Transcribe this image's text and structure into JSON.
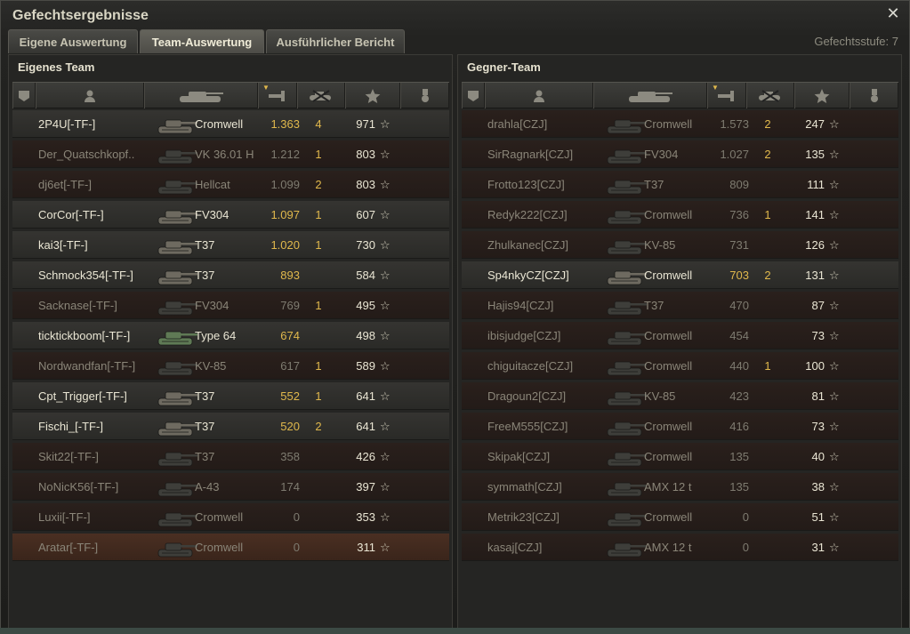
{
  "window": {
    "title": "Gefechtsergebnisse",
    "close_glyph": "✕"
  },
  "tabs": [
    {
      "label": "Eigene Auswertung",
      "active": false
    },
    {
      "label": "Team-Auswertung",
      "active": true
    },
    {
      "label": "Ausführlicher Bericht",
      "active": false
    }
  ],
  "battle_tier": "Gefechtsstufe: 7",
  "columns": [
    "squad-icon",
    "player-icon",
    "tank-icon",
    "damage-icon",
    "kills-icon",
    "xp-star-icon",
    "medal-icon"
  ],
  "own_team": {
    "title": "Eigenes Team",
    "rows": [
      {
        "name": "2P4U[-TF-]",
        "tank": "Cromwell",
        "damage": "1.363",
        "kills": "4",
        "xp": "971",
        "state": "alive",
        "tank_color": "#6e6a60"
      },
      {
        "name": "Der_Quatschkopf..",
        "tank": "VK 36.01 H",
        "damage": "1.212",
        "kills": "1",
        "xp": "803",
        "state": "dead",
        "tank_color": "#3e3e3a"
      },
      {
        "name": "dj6et[-TF-]",
        "tank": "Hellcat",
        "damage": "1.099",
        "kills": "2",
        "xp": "803",
        "state": "dead",
        "tank_color": "#3e3e3a"
      },
      {
        "name": "CorCor[-TF-]",
        "tank": "FV304",
        "damage": "1.097",
        "kills": "1",
        "xp": "607",
        "state": "alive",
        "tank_color": "#6e6a60"
      },
      {
        "name": "kai3[-TF-]",
        "tank": "T37",
        "damage": "1.020",
        "kills": "1",
        "xp": "730",
        "state": "alive",
        "tank_color": "#6e6a60"
      },
      {
        "name": "Schmock354[-TF-]",
        "tank": "T37",
        "damage": "893",
        "kills": "",
        "xp": "584",
        "state": "alive",
        "tank_color": "#6e6a60"
      },
      {
        "name": "Sacknase[-TF-]",
        "tank": "FV304",
        "damage": "769",
        "kills": "1",
        "xp": "495",
        "state": "dead",
        "tank_color": "#3e3e3a"
      },
      {
        "name": "ticktickboom[-TF-]",
        "tank": "Type 64",
        "damage": "674",
        "kills": "",
        "xp": "498",
        "state": "alive",
        "tank_color": "#5f7a55"
      },
      {
        "name": "Nordwandfan[-TF-]",
        "tank": "KV-85",
        "damage": "617",
        "kills": "1",
        "xp": "589",
        "state": "dead",
        "tank_color": "#3e3e3a"
      },
      {
        "name": "Cpt_Trigger[-TF-]",
        "tank": "T37",
        "damage": "552",
        "kills": "1",
        "xp": "641",
        "state": "alive",
        "tank_color": "#6e6a60"
      },
      {
        "name": "Fischi_[-TF-]",
        "tank": "T37",
        "damage": "520",
        "kills": "2",
        "xp": "641",
        "state": "alive",
        "tank_color": "#6e6a60"
      },
      {
        "name": "Skit22[-TF-]",
        "tank": "T37",
        "damage": "358",
        "kills": "",
        "xp": "426",
        "state": "dead",
        "tank_color": "#3e3e3a"
      },
      {
        "name": "NoNicK56[-TF-]",
        "tank": "A-43",
        "damage": "174",
        "kills": "",
        "xp": "397",
        "state": "dead",
        "tank_color": "#3e3e3a"
      },
      {
        "name": "Luxii[-TF-]",
        "tank": "Cromwell",
        "damage": "0",
        "kills": "",
        "xp": "353",
        "state": "dead",
        "tank_color": "#3e3e3a"
      },
      {
        "name": "Aratar[-TF-]",
        "tank": "Cromwell",
        "damage": "0",
        "kills": "",
        "xp": "311",
        "state": "self",
        "tank_color": "#3e3e3a"
      }
    ]
  },
  "enemy_team": {
    "title": "Gegner-Team",
    "rows": [
      {
        "name": "drahla[CZJ]",
        "tank": "Cromwell",
        "damage": "1.573",
        "kills": "2",
        "xp": "247",
        "state": "dead",
        "tank_color": "#3e3e3a"
      },
      {
        "name": "SirRagnark[CZJ]",
        "tank": "FV304",
        "damage": "1.027",
        "kills": "2",
        "xp": "135",
        "state": "dead",
        "tank_color": "#3e3e3a"
      },
      {
        "name": "Frotto123[CZJ]",
        "tank": "T37",
        "damage": "809",
        "kills": "",
        "xp": "111",
        "state": "dead",
        "tank_color": "#3e3e3a"
      },
      {
        "name": "Redyk222[CZJ]",
        "tank": "Cromwell",
        "damage": "736",
        "kills": "1",
        "xp": "141",
        "state": "dead",
        "tank_color": "#3e3e3a"
      },
      {
        "name": "Zhulkanec[CZJ]",
        "tank": "KV-85",
        "damage": "731",
        "kills": "",
        "xp": "126",
        "state": "dead",
        "tank_color": "#3e3e3a"
      },
      {
        "name": "Sp4nkyCZ[CZJ]",
        "tank": "Cromwell",
        "damage": "703",
        "kills": "2",
        "xp": "131",
        "state": "alive",
        "tank_color": "#6e6a60"
      },
      {
        "name": "Hajis94[CZJ]",
        "tank": "T37",
        "damage": "470",
        "kills": "",
        "xp": "87",
        "state": "dead",
        "tank_color": "#3e3e3a"
      },
      {
        "name": "ibisjudge[CZJ]",
        "tank": "Cromwell",
        "damage": "454",
        "kills": "",
        "xp": "73",
        "state": "dead",
        "tank_color": "#3e3e3a"
      },
      {
        "name": "chiguitacze[CZJ]",
        "tank": "Cromwell",
        "damage": "440",
        "kills": "1",
        "xp": "100",
        "state": "dead",
        "tank_color": "#3e3e3a"
      },
      {
        "name": "Dragoun2[CZJ]",
        "tank": "KV-85",
        "damage": "423",
        "kills": "",
        "xp": "81",
        "state": "dead",
        "tank_color": "#3e3e3a"
      },
      {
        "name": "FreeM555[CZJ]",
        "tank": "Cromwell",
        "damage": "416",
        "kills": "",
        "xp": "73",
        "state": "dead",
        "tank_color": "#3e3e3a"
      },
      {
        "name": "Skipak[CZJ]",
        "tank": "Cromwell",
        "damage": "135",
        "kills": "",
        "xp": "40",
        "state": "dead",
        "tank_color": "#3e3e3a"
      },
      {
        "name": "symmath[CZJ]",
        "tank": "AMX 12 t",
        "damage": "135",
        "kills": "",
        "xp": "38",
        "state": "dead",
        "tank_color": "#3e3e3a"
      },
      {
        "name": "Metrik23[CZJ]",
        "tank": "Cromwell",
        "damage": "0",
        "kills": "",
        "xp": "51",
        "state": "dead",
        "tank_color": "#3e3e3a"
      },
      {
        "name": "kasaj[CZJ]",
        "tank": "AMX 12 t",
        "damage": "0",
        "kills": "",
        "xp": "31",
        "state": "dead",
        "tank_color": "#3e3e3a"
      }
    ]
  }
}
